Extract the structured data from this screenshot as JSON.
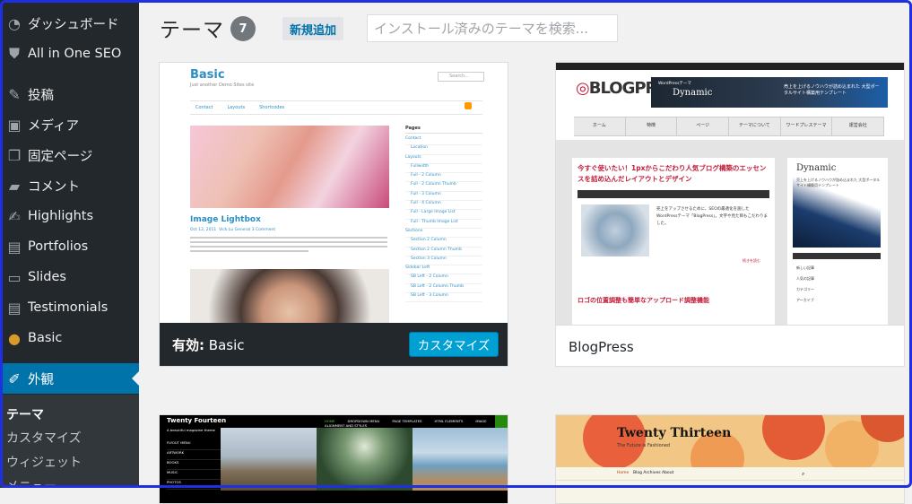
{
  "sidebar": {
    "items": [
      {
        "label": "ダッシュボード",
        "icon": "dashboard-icon",
        "glyph": "◔"
      },
      {
        "label": "All in One SEO",
        "icon": "shield-icon",
        "glyph": "⛊"
      },
      {
        "label": "投稿",
        "icon": "pushpin-icon",
        "glyph": "✎"
      },
      {
        "label": "メディア",
        "icon": "media-icon",
        "glyph": "▣"
      },
      {
        "label": "固定ページ",
        "icon": "page-icon",
        "glyph": "❐"
      },
      {
        "label": "コメント",
        "icon": "comment-icon",
        "glyph": "▰"
      },
      {
        "label": "Highlights",
        "icon": "edit-icon",
        "glyph": "✍"
      },
      {
        "label": "Portfolios",
        "icon": "folder-icon",
        "glyph": "▤"
      },
      {
        "label": "Slides",
        "icon": "slides-icon",
        "glyph": "▭"
      },
      {
        "label": "Testimonials",
        "icon": "testimonial-icon",
        "glyph": "▤"
      },
      {
        "label": "Basic",
        "icon": "basic-theme-icon",
        "glyph": "●"
      },
      {
        "label": "外観",
        "icon": "appearance-icon",
        "glyph": "✐"
      }
    ],
    "submenu": [
      {
        "label": "テーマ"
      },
      {
        "label": "カスタマイズ"
      },
      {
        "label": "ウィジェット"
      },
      {
        "label": "メニュー"
      }
    ]
  },
  "header": {
    "title": "テーマ",
    "count": "7",
    "add_new": "新規追加",
    "search_placeholder": "インストール済みのテーマを検索..."
  },
  "themes": {
    "basic": {
      "active_prefix": "有効:",
      "name": "Basic",
      "customize": "カスタマイズ",
      "shot": {
        "title": "Basic",
        "tagline": "Just another Demo Sites site",
        "search": "Search...",
        "nav": [
          "Contact",
          "Layouts",
          "Shortcodes"
        ],
        "post_title": "Image Lightbox",
        "post_date": "Oct 12, 2011",
        "post_meta": "Vick Lu   General   3 Comment",
        "side_heading": "Pages",
        "side_links": [
          "Contact",
          "Location",
          "Layouts",
          "Fullwidth",
          "Full - 2 Column",
          "Full - 2 Column Thumb",
          "Full - 3 Column",
          "Full - 4 Column",
          "Full - Large Image List",
          "Full - Thumb Image List",
          "Sections",
          "Section 2 Column",
          "Section 2 Column Thumb",
          "Section 3 Column",
          "Sidebar Left",
          "SB Left - 2 Column",
          "SB Left - 2 Column Thumb",
          "SB Left - 3 Column"
        ]
      }
    },
    "blogpress": {
      "name": "BlogPress",
      "shot": {
        "logo": "BLOGPRESS",
        "banner_label": "WordPressテーマ",
        "banner_name": "Dynamic",
        "banner_text": "売上を上げるノウハウが詰め込まれた 大型ポータルサイト構築用テンプレート",
        "nav": [
          "ホーム",
          "特徴",
          "ページ",
          "テーマについて",
          "ワードプレステーマ",
          "運営会社"
        ],
        "headline": "今すぐ使いたい！1pxからこだわり人気ブログ構築のエッセンスを詰め込んだレイアウトとデザイン",
        "excerpt": "売上をアップさせるために、SEOの最適化を施したWordPressテーマ「BlogPress」。文字や見た目もこだわりました。",
        "more": "続きを読む",
        "second_headline": "ロゴの位置調整も簡単なアップロード調整機能",
        "ad_name": "Dynamic",
        "ad_text": "売上を上げるノウハウが詰め込まれた 大型ポータルサイト構築用テンプレート",
        "side_links": [
          "新しい記事",
          "人気の記事",
          "カテゴリー",
          "アーカイブ"
        ]
      }
    },
    "twentyfourteen": {
      "shot": {
        "name": "Twenty Fourteen",
        "tagline": "A beautiful magazine theme",
        "menu": [
          "HOME",
          "DROPDOWN MENU",
          "PAGE TEMPLATES",
          "HTML ELEMENTS",
          "IMAGE ALIGNMENT AND STYLES"
        ],
        "side": [
          "FLYOUT MENU",
          "ARTWORK",
          "BOOKS",
          "MUSIC",
          "PHOTOS"
        ]
      }
    },
    "twentythirteen": {
      "shot": {
        "name": "Twenty Thirteen",
        "tagline": "The Future is Fashioned",
        "nav": [
          "Home",
          "Blog Archives",
          "About"
        ]
      }
    }
  },
  "colors": {
    "sidebar_bg": "#23282d",
    "accent": "#0073aa",
    "button": "#00a0d2",
    "frame": "#1f30e0"
  }
}
